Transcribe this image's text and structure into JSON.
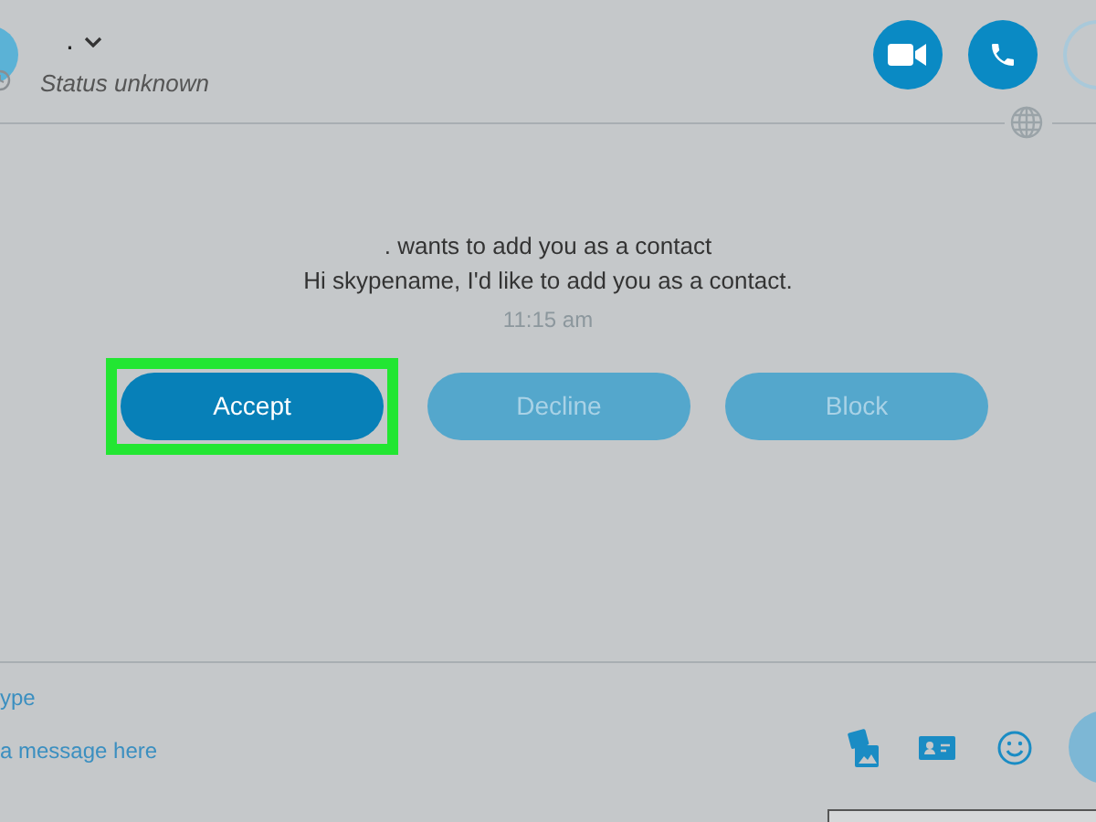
{
  "header": {
    "contact_name": ".",
    "status": "Status unknown"
  },
  "request": {
    "line_1": ". wants to add you as a contact",
    "line_2": "Hi skypename, I'd like to add you as a contact.",
    "time": "11:15 am"
  },
  "buttons": [
    {
      "label": "Accept",
      "kind": "primary",
      "highlighted": true
    },
    {
      "label": "Decline",
      "kind": "secondary",
      "highlighted": false
    },
    {
      "label": "Block",
      "kind": "secondary",
      "highlighted": false
    }
  ],
  "composer": {
    "label": "ype",
    "placeholder": "a message here"
  }
}
